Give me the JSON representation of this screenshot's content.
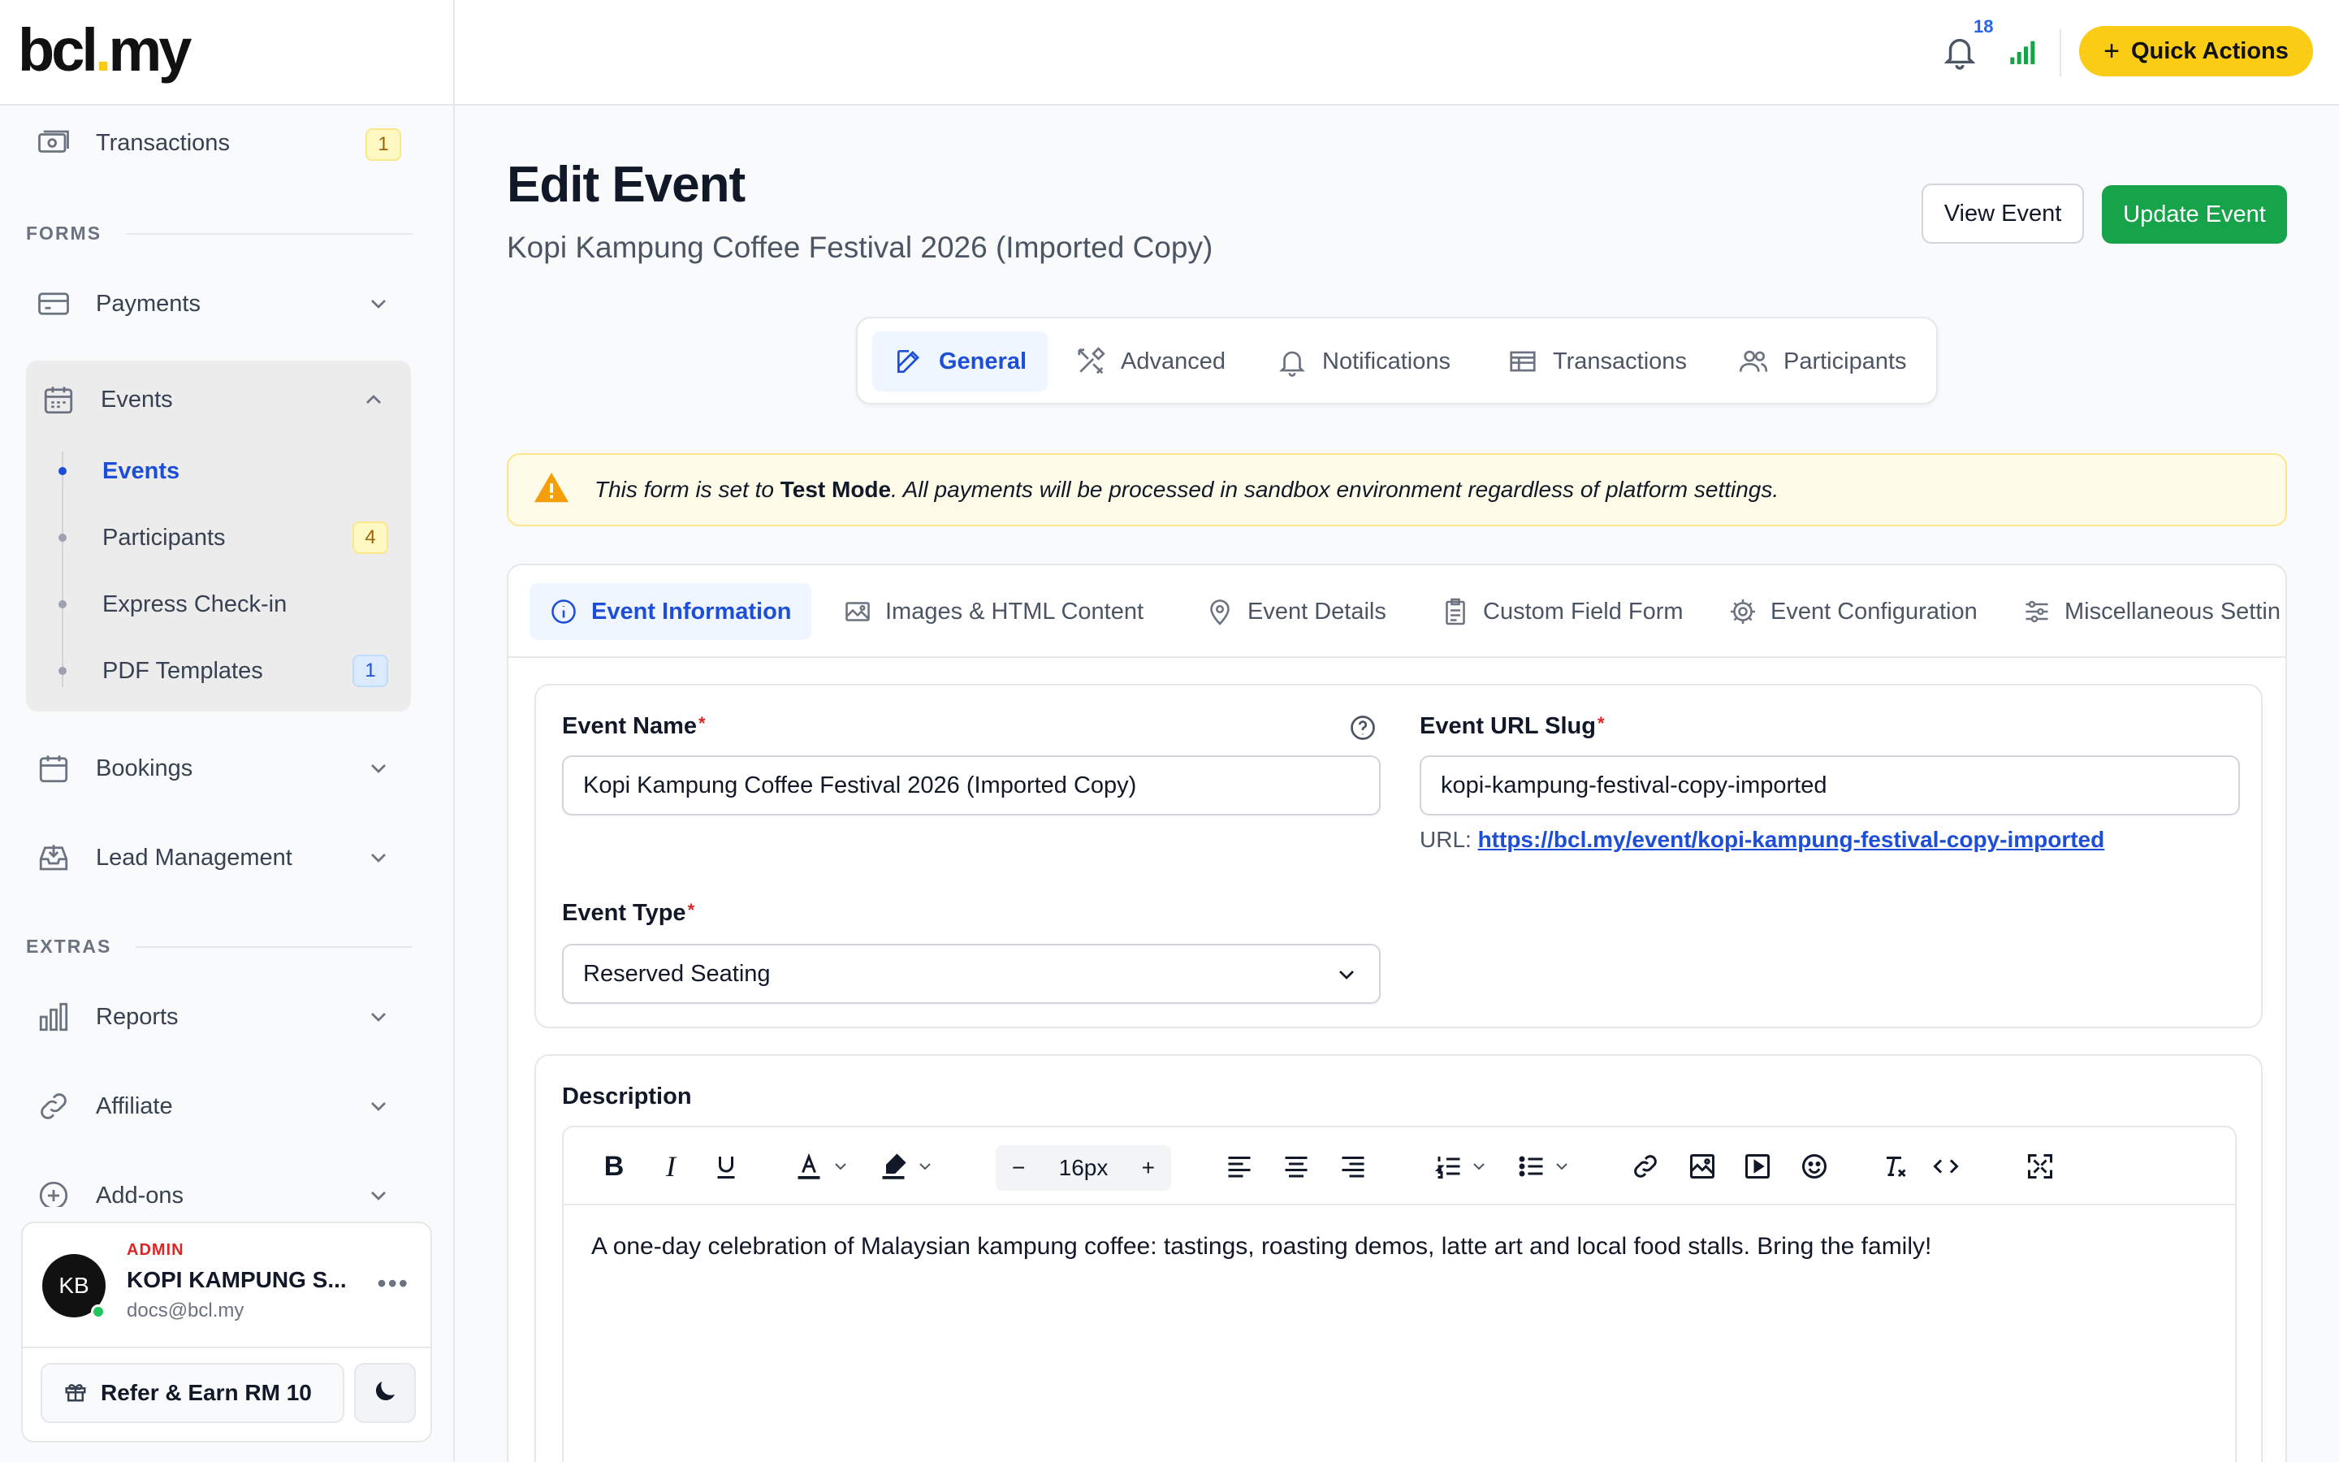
{
  "brand": {
    "logo_main": "bcl",
    "logo_dot": ".",
    "logo_tail": "my"
  },
  "sidebar": {
    "transactions": {
      "label": "Transactions",
      "badge": "1"
    },
    "forms_heading": "FORMS",
    "payments": {
      "label": "Payments"
    },
    "events": {
      "label": "Events",
      "children": [
        {
          "label": "Events",
          "active": true
        },
        {
          "label": "Participants",
          "badge": "4"
        },
        {
          "label": "Express Check-in"
        },
        {
          "label": "PDF Templates",
          "badge": "1"
        }
      ]
    },
    "bookings": {
      "label": "Bookings"
    },
    "lead_management": {
      "label": "Lead Management"
    },
    "extras_heading": "EXTRAS",
    "reports": {
      "label": "Reports"
    },
    "affiliate": {
      "label": "Affiliate"
    },
    "addons": {
      "label": "Add-ons"
    }
  },
  "user": {
    "initials": "KB",
    "role": "ADMIN",
    "name": "KOPI KAMPUNG S...",
    "email": "docs@bcl.my",
    "more": "•••",
    "refer_label": "Refer & Earn RM 10"
  },
  "topbar": {
    "notification_count": "18",
    "quick_actions_label": "Quick Actions",
    "quick_actions_color": "#facc15"
  },
  "page": {
    "title": "Edit Event",
    "subtitle": "Kopi Kampung Coffee Festival 2026 (Imported Copy)",
    "view_button": "View Event",
    "update_button": "Update Event",
    "update_color": "#16a34a"
  },
  "tabs": [
    {
      "label": "General",
      "icon": "edit-icon",
      "active": true
    },
    {
      "label": "Advanced",
      "icon": "tools-icon"
    },
    {
      "label": "Notifications",
      "icon": "bell-icon"
    },
    {
      "label": "Transactions",
      "icon": "table-icon"
    },
    {
      "label": "Participants",
      "icon": "users-icon"
    }
  ],
  "alert": {
    "prefix": "This form is set to ",
    "mode": "Test Mode",
    "suffix": ". All payments will be processed in sandbox environment regardless of platform settings."
  },
  "subtabs": [
    {
      "label": "Event Information",
      "icon": "info-icon",
      "active": true
    },
    {
      "label": "Images & HTML Content",
      "icon": "image-icon"
    },
    {
      "label": "Event Details",
      "icon": "map-pin-icon"
    },
    {
      "label": "Custom Field Form",
      "icon": "clipboard-icon"
    },
    {
      "label": "Event Configuration",
      "icon": "gear-icon"
    },
    {
      "label": "Miscellaneous Settin",
      "icon": "sliders-icon"
    }
  ],
  "form": {
    "event_name_label": "Event Name",
    "event_name_value": "Kopi Kampung Coffee Festival 2026 (Imported Copy)",
    "slug_label": "Event URL Slug",
    "slug_value": "kopi-kampung-festival-copy-imported",
    "url_prefix": "URL: ",
    "url_value": "https://bcl.my/event/kopi-kampung-festival-copy-imported",
    "event_type_label": "Event Type",
    "event_type_value": "Reserved Seating",
    "required_mark": "*"
  },
  "description": {
    "label": "Description",
    "font_size": "16px",
    "minus": "−",
    "plus": "+",
    "content": "A one-day celebration of Malaysian kampung coffee: tastings, roasting demos, latte art and local food stalls. Bring the family!"
  }
}
